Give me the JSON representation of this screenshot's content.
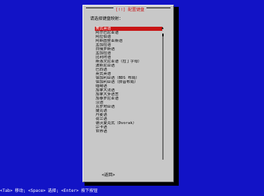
{
  "dialog": {
    "title": "[!!] 配置键盘",
    "prompt": "请选择键盘映射：",
    "back_label": "<返回>",
    "scroll_up_indicator": "▲"
  },
  "keymaps": [
    "美式英语",
    "阿尔巴尼亚语",
    "阿拉伯语",
    "阿斯图里亚斯语",
    "孟加拉语",
    "白俄罗斯语",
    "孟加拉语",
    "比利时语",
    "斯洛文尼亚语（拉丁字母）",
    "波斯尼亚语",
    "巴西语",
    "英式英语",
    "保加利亚语（BDS 布局）",
    "保加利亚语（拼音布局）",
    "缅甸语",
    "加拿大法语",
    "加拿大多语言",
    "加泰罗尼亚语",
    "汉语",
    "克罗地亚语",
    "捷克语",
    "丹麦语",
    "荷兰语",
    "德沃夏克式（Dvorak）",
    "宗卡语",
    "世界语"
  ],
  "selected_index": 0,
  "scroll_position": 0.0,
  "colors": {
    "background": "#1213c6",
    "dialog": "#c8c8c8",
    "highlight": "#c81414",
    "title_text": "#c81414"
  },
  "hint": "<Tab> 移动; <Space> 选择; <Enter> 按下按钮"
}
